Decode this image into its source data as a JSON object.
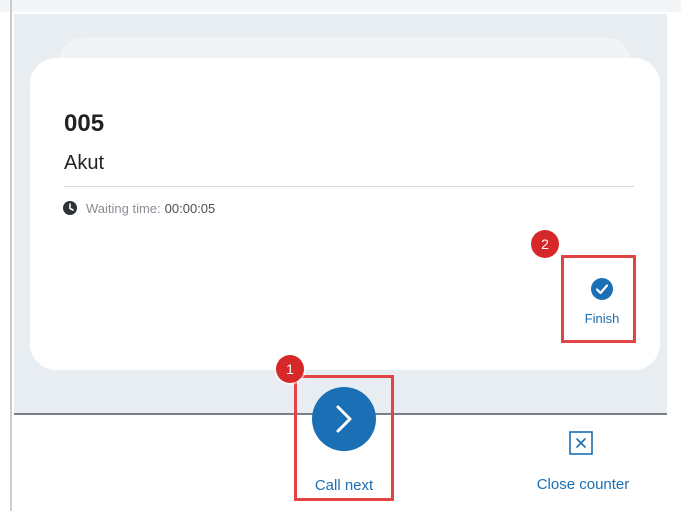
{
  "ticket": {
    "number": "005",
    "service": "Akut",
    "waiting_label": "Waiting time:",
    "waiting_value": "00:00:05"
  },
  "actions": {
    "finish_label": "Finish",
    "call_next_label": "Call next",
    "close_counter_label": "Close counter"
  },
  "annotations": {
    "badge_1": "1",
    "badge_2": "2"
  },
  "icons": {
    "clock": "clock-icon",
    "finish": "check-circle-icon",
    "call_next": "chevron-right-icon",
    "close_counter": "close-box-icon"
  },
  "colors": {
    "accent": "#1a6fb5",
    "highlight": "#e24444",
    "badge": "#d62828",
    "panel": "#e8edf2"
  }
}
